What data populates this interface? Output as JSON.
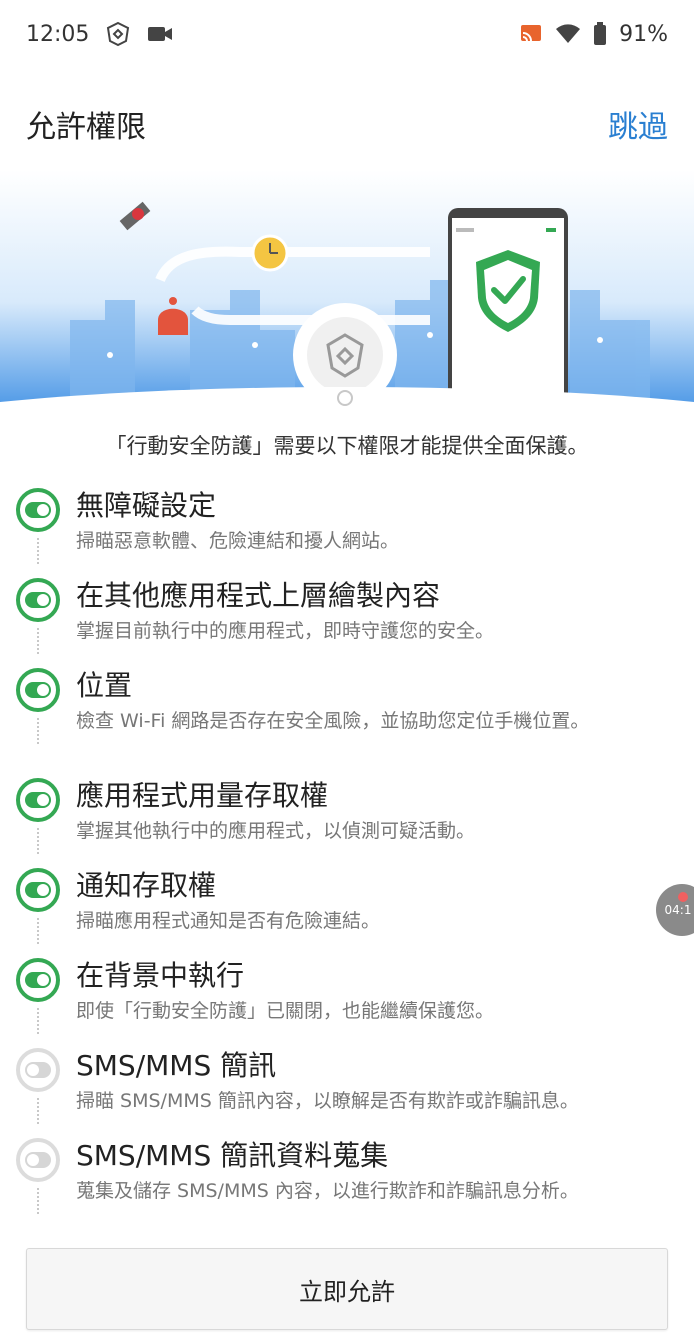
{
  "status_bar": {
    "time": "12:05",
    "battery": "91%",
    "icons": [
      "app-shield-icon",
      "video-icon",
      "cast-icon",
      "wifi-icon",
      "battery-icon"
    ]
  },
  "header": {
    "title": "允許權限",
    "skip_label": "跳過"
  },
  "intro_text": "「行動安全防護」需要以下權限才能提供全面保護。",
  "permissions": [
    {
      "title": "無障礙設定",
      "desc": "掃瞄惡意軟體、危險連結和擾人網站。",
      "enabled": true
    },
    {
      "title": "在其他應用程式上層繪製內容",
      "desc": "掌握目前執行中的應用程式，即時守護您的安全。",
      "enabled": true
    },
    {
      "title": "位置",
      "desc": "檢查 Wi-Fi 網路是否存在安全風險，並協助您定位手機位置。",
      "enabled": true
    },
    {
      "title": "應用程式用量存取權",
      "desc": "掌握其他執行中的應用程式，以偵測可疑活動。",
      "enabled": true
    },
    {
      "title": "通知存取權",
      "desc": "掃瞄應用程式通知是否有危險連結。",
      "enabled": true
    },
    {
      "title": "在背景中執行",
      "desc": "即使「行動安全防護」已關閉，也能繼續保護您。",
      "enabled": true
    },
    {
      "title": "SMS/MMS 簡訊",
      "desc": "掃瞄 SMS/MMS 簡訊內容，以瞭解是否有欺詐或詐騙訊息。",
      "enabled": false
    },
    {
      "title": "SMS/MMS 簡訊資料蒐集",
      "desc": "蒐集及儲存 SMS/MMS 內容，以進行欺詐和詐騙訊息分析。",
      "enabled": false
    }
  ],
  "allow_button_label": "立即允許",
  "floating_timer": "04:1",
  "colors": {
    "accent_blue": "#2a7fd1",
    "toggle_on": "#34a853",
    "toggle_off": "#d6d6d6"
  }
}
